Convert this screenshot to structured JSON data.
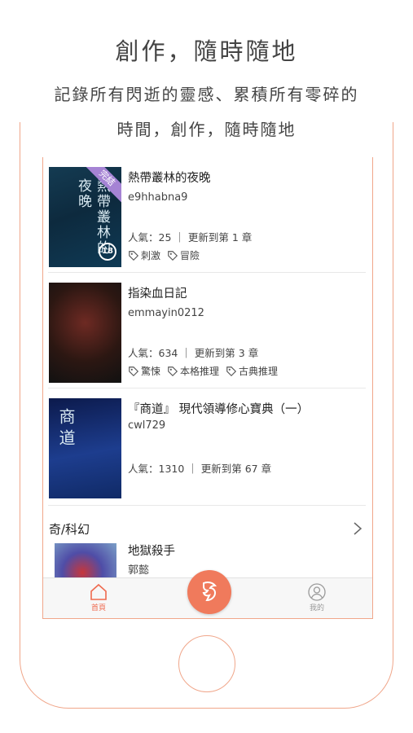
{
  "promo": {
    "headline": "創作，隨時隨地",
    "line1": "記錄所有閃逝的靈感、累積所有零碎的",
    "line2": "時間，創作，隨時隨地"
  },
  "books": [
    {
      "title": "熱帶叢林的夜晚",
      "author": "e9hhabna9",
      "meta": "人氣：25 ｜ 更新到第 1 章",
      "tags": [
        "刺激",
        "冒險"
      ],
      "cover_text": "熱帶叢林的夜晚",
      "badge": "完結",
      "rating": "18"
    },
    {
      "title": "指染血日記",
      "author": "emmayin0212",
      "meta": "人氣：634 ｜ 更新到第 3 章",
      "tags": [
        "驚悚",
        "本格推理",
        "古典推理"
      ]
    },
    {
      "title": "『商道』 現代領導修心寶典（一）",
      "author": "cwl729",
      "meta": "人氣：1310 ｜ 更新到第 67 章",
      "tags": [],
      "cover_text": "商道"
    }
  ],
  "section": {
    "title": "奇/科幻",
    "book": {
      "title": "地獄殺手",
      "author": "郭懿"
    }
  },
  "tabbar": {
    "home": "首頁",
    "me": "我的"
  },
  "colors": {
    "accent": "#f07a5c",
    "phone_outline": "#f0a68a"
  }
}
